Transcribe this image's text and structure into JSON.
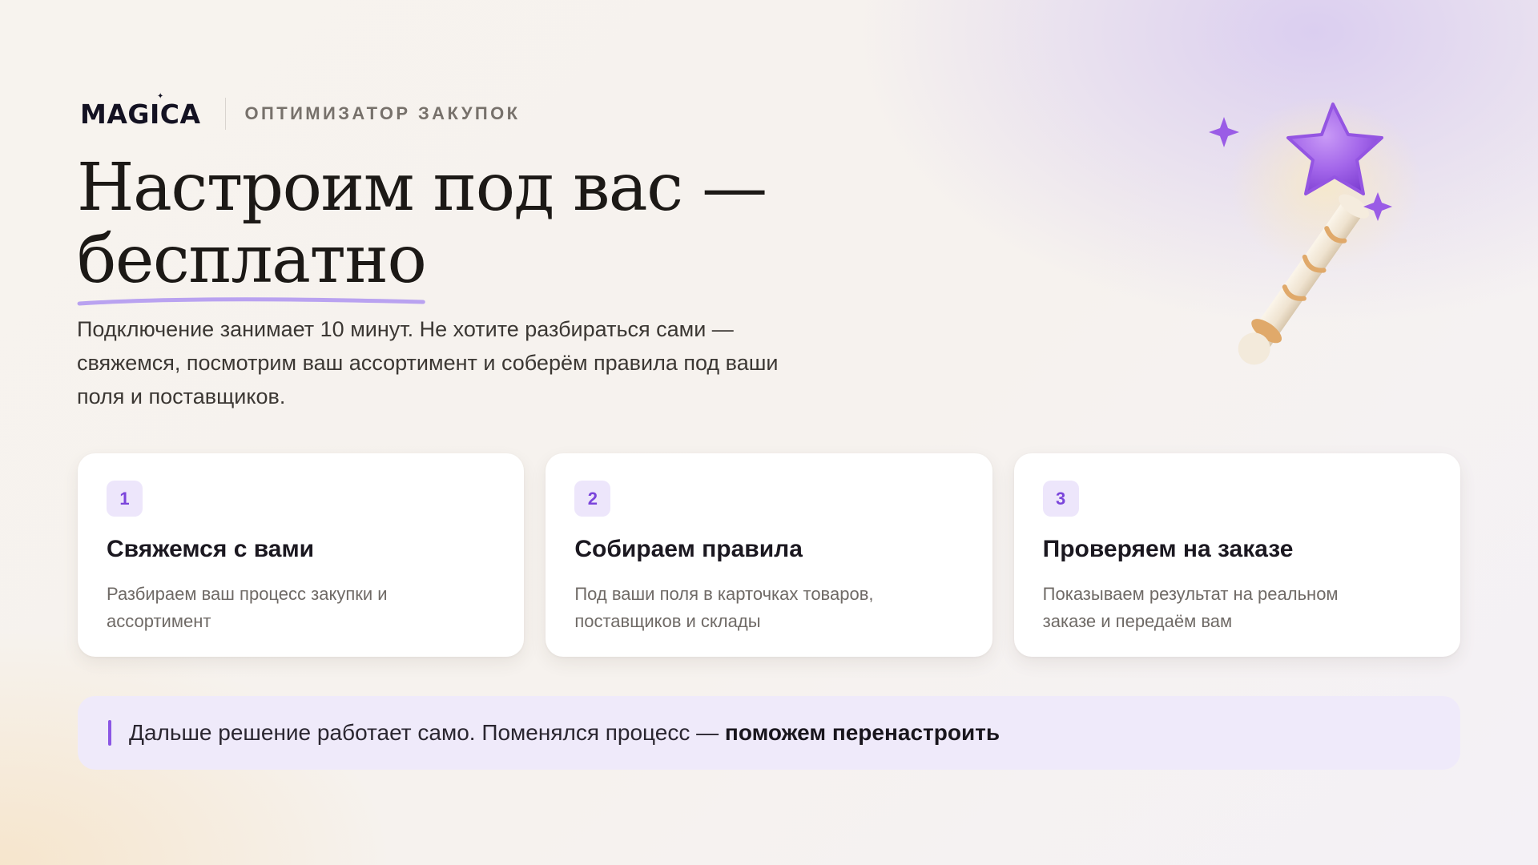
{
  "brand": {
    "logo_text": "MAGICA",
    "tagline": "ОПТИМИЗАТОР ЗАКУПОК"
  },
  "hero": {
    "title_line1": "Настроим под вас —",
    "title_line2": "бесплатно",
    "subtitle": "Подключение занимает 10 минут. Не хотите разбираться сами — свяжемся, посмотрим ваш ассортимент и соберём правила под ваши поля и поставщиков."
  },
  "illustration": {
    "icon": "magic-wand-icon"
  },
  "steps": [
    {
      "number": "1",
      "title": "Свяжемся с вами",
      "text": "Разбираем ваш процесс закупки и ассортимент"
    },
    {
      "number": "2",
      "title": "Собираем правила",
      "text": "Под ваши поля в карточках товаров, поставщиков и склады"
    },
    {
      "number": "3",
      "title": "Проверяем на заказе",
      "text": "Показываем результат на реальном заказе и передаём вам"
    }
  ],
  "note": {
    "text": "Дальше решение работает само. Поменялся процесс — ",
    "strong": "поможем перенастроить"
  },
  "colors": {
    "accent": "#8b56e4",
    "badge_bg": "#ede6fb",
    "note_bg": "#efeafa",
    "wand_star": "#a366ea",
    "wand_handle": "#efe4d2",
    "wand_ribbon": "#e0a96a"
  }
}
